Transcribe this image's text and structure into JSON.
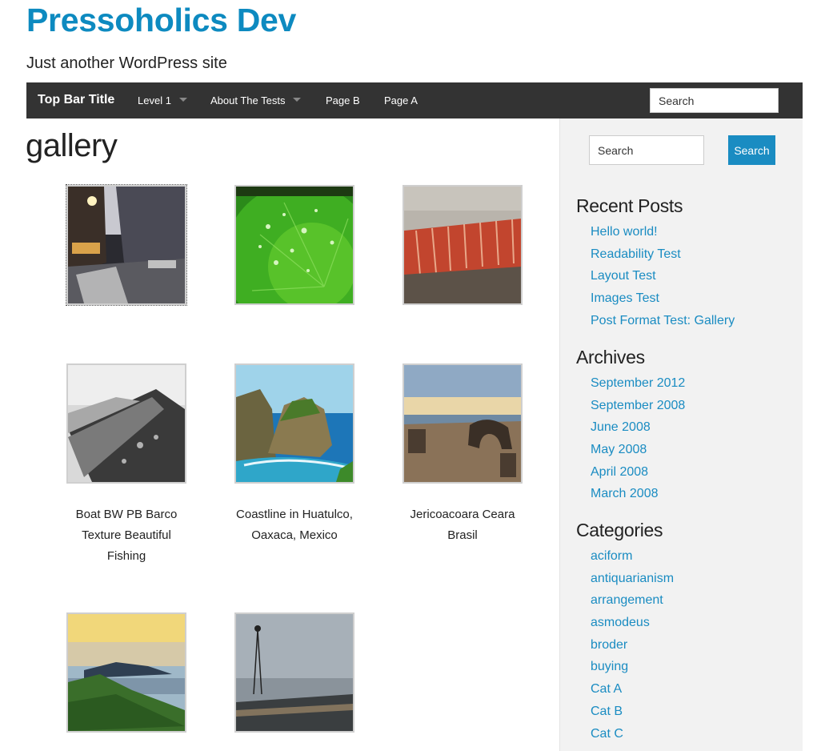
{
  "site": {
    "title": "Pressoholics Dev",
    "description": "Just another WordPress site"
  },
  "topbar": {
    "brand": "Top Bar Title",
    "items": [
      {
        "label": "Level 1",
        "has_dropdown": true
      },
      {
        "label": "About The Tests",
        "has_dropdown": true
      },
      {
        "label": "Page B",
        "has_dropdown": false
      },
      {
        "label": "Page A",
        "has_dropdown": false
      }
    ],
    "search_value": "Search"
  },
  "page": {
    "title": "gallery"
  },
  "gallery": {
    "items": [
      {
        "image": "city-street-night",
        "caption": ""
      },
      {
        "image": "green-leaf-water-drops",
        "caption": ""
      },
      {
        "image": "red-crystal-rock",
        "caption": ""
      },
      {
        "image": "boat-bw-texture",
        "caption": "Boat BW PB Barco Texture Beautiful Fishing"
      },
      {
        "image": "coastline-rocks-sea",
        "caption": "Coastline in Huatulco, Oaxaca, Mexico"
      },
      {
        "image": "beach-rock-arch",
        "caption": "Jericoacoara Ceara Brasil"
      },
      {
        "image": "sunset-coast-hills",
        "caption": ""
      },
      {
        "image": "foggy-windmill",
        "caption": ""
      }
    ]
  },
  "sidebar": {
    "search_value": "Search",
    "search_button": "Search",
    "recent_posts": {
      "title": "Recent Posts",
      "items": [
        "Hello world!",
        "Readability Test",
        "Layout Test",
        "Images Test",
        "Post Format Test: Gallery"
      ]
    },
    "archives": {
      "title": "Archives",
      "items": [
        "September 2012",
        "September 2008",
        "June 2008",
        "May 2008",
        "April 2008",
        "March 2008"
      ]
    },
    "categories": {
      "title": "Categories",
      "items": [
        "aciform",
        "antiquarianism",
        "arrangement",
        "asmodeus",
        "broder",
        "buying",
        "Cat A",
        "Cat B",
        "Cat C"
      ]
    }
  },
  "colors": {
    "brand_blue": "#0d8ac0",
    "link": "#1a8cc2",
    "topbar_bg": "#333333",
    "sidebar_bg": "#f2f2f2"
  }
}
